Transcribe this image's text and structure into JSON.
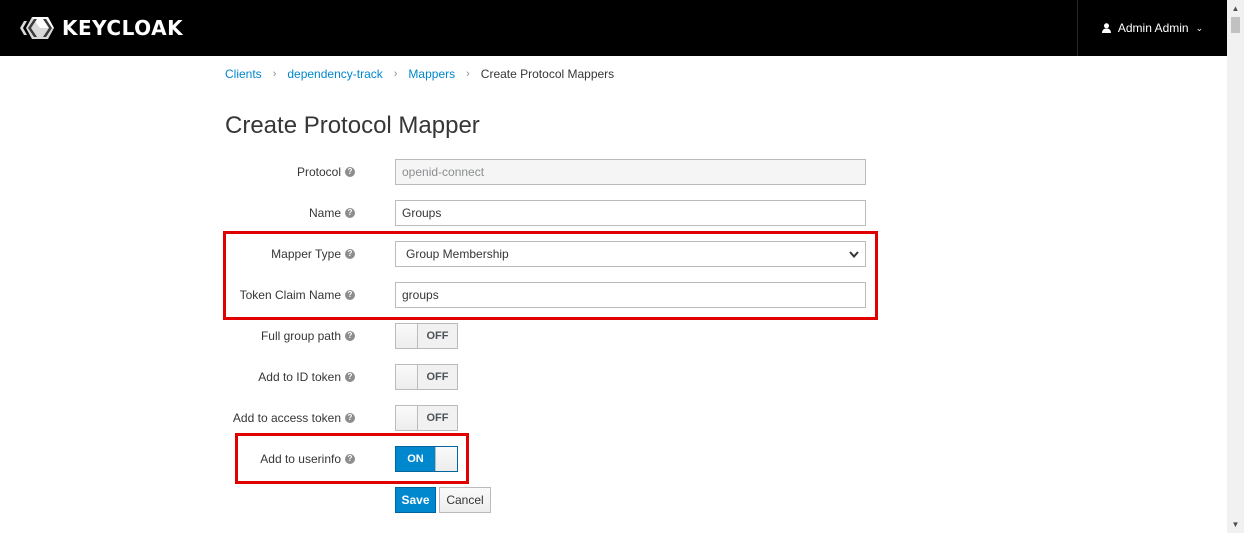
{
  "header": {
    "brand": "KEYCLOAK",
    "user_name": "Admin Admin"
  },
  "breadcrumb": {
    "items": [
      "Clients",
      "dependency-track",
      "Mappers"
    ],
    "current": "Create Protocol Mappers"
  },
  "page_title": "Create Protocol Mapper",
  "form": {
    "protocol": {
      "label": "Protocol",
      "value": "openid-connect"
    },
    "name": {
      "label": "Name",
      "value": "Groups"
    },
    "mapper_type": {
      "label": "Mapper Type",
      "value": "Group Membership"
    },
    "token_claim_name": {
      "label": "Token Claim Name",
      "value": "groups"
    },
    "full_group_path": {
      "label": "Full group path",
      "state": "OFF"
    },
    "add_to_id_token": {
      "label": "Add to ID token",
      "state": "OFF"
    },
    "add_to_access_token": {
      "label": "Add to access token",
      "state": "OFF"
    },
    "add_to_userinfo": {
      "label": "Add to userinfo",
      "state": "ON"
    }
  },
  "buttons": {
    "save": "Save",
    "cancel": "Cancel"
  },
  "colors": {
    "topbar": "#000000",
    "link": "#0088ce",
    "primary": "#0088ce",
    "highlight": "#e00000"
  },
  "icons": {
    "help": "question-circle-icon",
    "user": "user-icon",
    "dropdown": "chevron-down-icon"
  }
}
